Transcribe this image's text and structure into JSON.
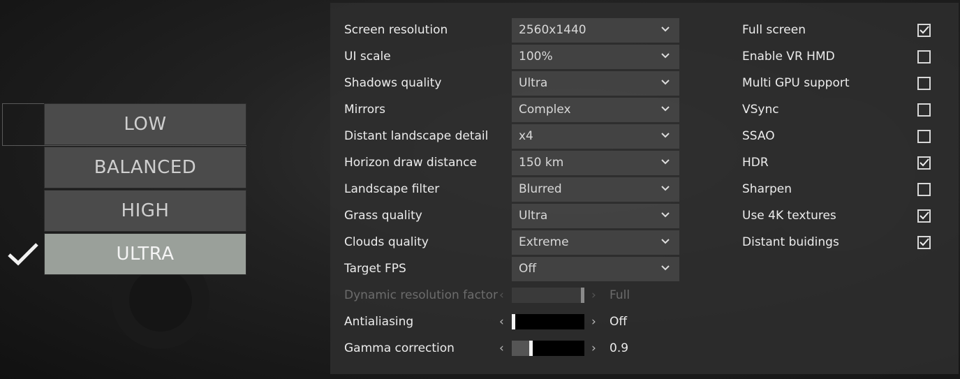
{
  "presets": {
    "items": [
      {
        "label": "LOW",
        "selected": false
      },
      {
        "label": "BALANCED",
        "selected": false
      },
      {
        "label": "HIGH",
        "selected": false
      },
      {
        "label": "ULTRA",
        "selected": true
      }
    ]
  },
  "settings": {
    "selects": [
      {
        "label": "Screen resolution",
        "value": "2560x1440"
      },
      {
        "label": "UI scale",
        "value": "100%"
      },
      {
        "label": "Shadows quality",
        "value": "Ultra"
      },
      {
        "label": "Mirrors",
        "value": "Complex"
      },
      {
        "label": "Distant landscape detail",
        "value": "x4"
      },
      {
        "label": "Horizon draw distance",
        "value": "150 km"
      },
      {
        "label": "Landscape filter",
        "value": "Blurred"
      },
      {
        "label": "Grass quality",
        "value": "Ultra"
      },
      {
        "label": "Clouds quality",
        "value": "Extreme"
      },
      {
        "label": "Target FPS",
        "value": "Off"
      }
    ],
    "sliders": [
      {
        "label": "Dynamic resolution factor",
        "value": "Full",
        "level": 1.0,
        "disabled": true
      },
      {
        "label": "Antialiasing",
        "value": "Off",
        "level": 0.0,
        "disabled": false
      },
      {
        "label": "Gamma correction",
        "value": "0.9",
        "level": 0.25,
        "disabled": false
      }
    ],
    "toggles": [
      {
        "label": "Full screen",
        "checked": true
      },
      {
        "label": "Enable VR HMD",
        "checked": false
      },
      {
        "label": "Multi GPU support",
        "checked": false
      },
      {
        "label": "VSync",
        "checked": false
      },
      {
        "label": "SSAO",
        "checked": false
      },
      {
        "label": "HDR",
        "checked": true
      },
      {
        "label": "Sharpen",
        "checked": false
      },
      {
        "label": "Use 4K textures",
        "checked": true
      },
      {
        "label": "Distant buidings",
        "checked": true
      }
    ]
  },
  "icons": {
    "select_arrow": "chevron-down-icon",
    "slider_left": "chevron-left-icon",
    "slider_right": "chevron-right-icon",
    "selected_preset": "checkmark-icon"
  }
}
